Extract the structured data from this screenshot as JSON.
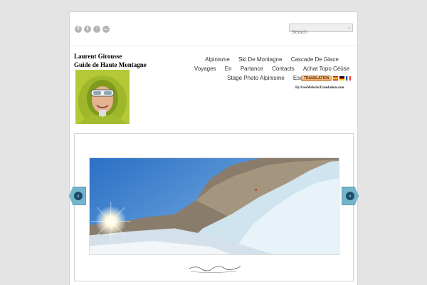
{
  "header": {
    "social_icons": [
      {
        "icon": "facebook-icon",
        "glyph": "f"
      },
      {
        "icon": "twitter-icon",
        "glyph": "t"
      },
      {
        "icon": "rss-icon",
        "glyph": "◦"
      },
      {
        "icon": "chat-icon",
        "glyph": "…"
      }
    ],
    "search": {
      "placeholder": "Search",
      "icon": "search-icon",
      "glyph": "⌕"
    }
  },
  "logo": {
    "line1": "Laurent Girousse",
    "line2": "Guide de Haute Montagne"
  },
  "nav": {
    "items": [
      {
        "label": "Alpinisme"
      },
      {
        "label": "Ski De Montagne"
      },
      {
        "label": "Cascade De Glace"
      },
      {
        "label": "Voyages"
      },
      {
        "label": "En"
      },
      {
        "label": "Partance"
      },
      {
        "label": "Contacts"
      },
      {
        "label": "Achat Topo Céüse"
      },
      {
        "label": "Stage Photo Alpinisme"
      },
      {
        "label": "Escalade"
      }
    ]
  },
  "translation": {
    "button_label": "TRANSLATION",
    "credit": "By FreeWebsiteTranslation.com",
    "flags": [
      "es-flag-icon",
      "de-flag-icon",
      "fr-flag-icon"
    ]
  },
  "slider": {
    "prev_glyph": "‹",
    "next_glyph": "›"
  },
  "colors": {
    "accent": "#74b5cc",
    "arrow_knob": "#1c4d6c"
  }
}
